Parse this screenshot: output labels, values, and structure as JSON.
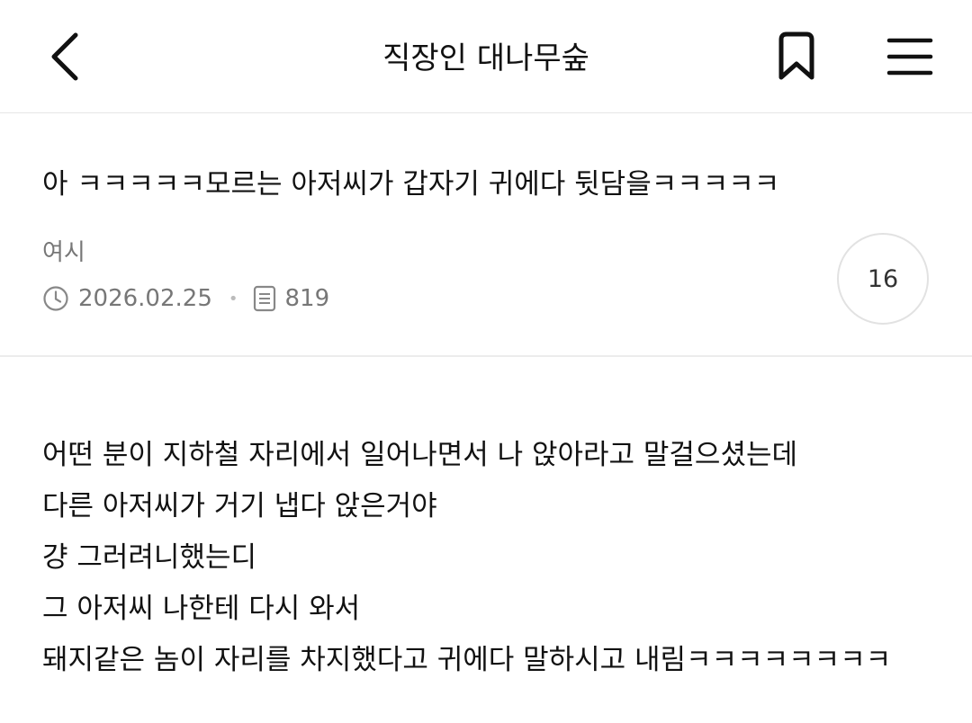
{
  "header": {
    "title": "직장인 대나무숲",
    "back_icon": "chevron-left-icon",
    "bookmark_icon": "bookmark-icon",
    "menu_icon": "hamburger-menu-icon"
  },
  "post": {
    "title": "아 ㅋㅋㅋㅋㅋ모르는 아저씨가 갑자기 귀에다 뒷담을ㅋㅋㅋㅋㅋ",
    "author": "여시",
    "date": "2026.02.25",
    "views": "819",
    "comment_count": "16",
    "separator": "•",
    "body_lines": [
      "어떤 분이 지하철 자리에서 일어나면서 나 앉아라고 말걸으셨는데",
      "다른 아저씨가 거기 냅다 앉은거야",
      "걍 그러려니했는디",
      "그 아저씨 나한테 다시 와서",
      "돼지같은 놈이 자리를 차지했다고 귀에다 말하시고 내림ㅋㅋㅋㅋㅋㅋㅋㅋ"
    ]
  }
}
